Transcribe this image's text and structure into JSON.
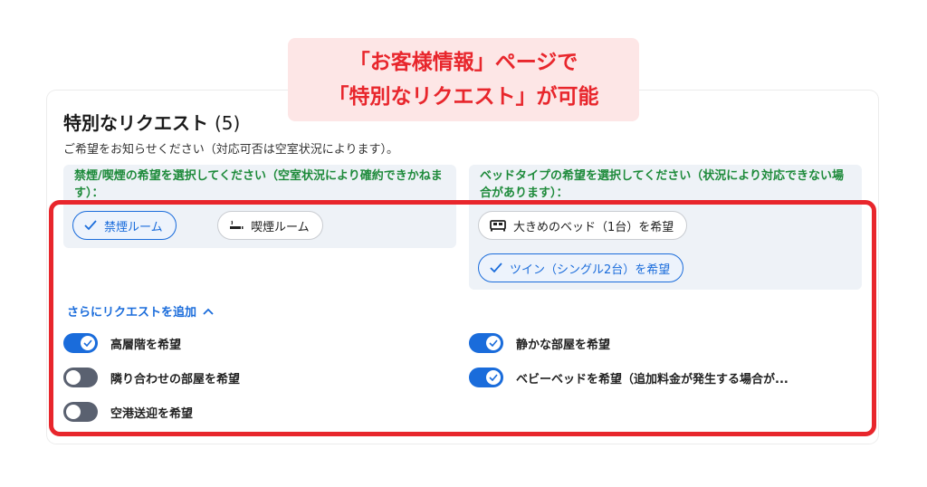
{
  "callout": {
    "line1": "「お客様情報」ページで",
    "line2": "「特別なリクエスト」が可能"
  },
  "section": {
    "title": "特別なリクエスト",
    "count": "(5)",
    "subtitle": "ご希望をお知らせください（対応可否は空室状況によります）。"
  },
  "smoking": {
    "heading": "禁煙/喫煙の希望を選択してください（空室状況により確約できかねます）：",
    "options": [
      {
        "label": "禁煙ルーム",
        "icon": "check-icon",
        "selected": true
      },
      {
        "label": "喫煙ルーム",
        "icon": "smoking-icon",
        "selected": false
      }
    ]
  },
  "bed": {
    "heading": "ベッドタイプの希望を選択してください（状況により対応できない場合があります）：",
    "options": [
      {
        "label": "大きめのベッド（1台）を希望",
        "icon": "bed-icon",
        "selected": false
      },
      {
        "label": "ツイン（シングル2台）を希望",
        "icon": "check-icon",
        "selected": true
      }
    ]
  },
  "more": {
    "label": "さらにリクエストを追加",
    "icon": "chevron-up-icon"
  },
  "toggles": [
    {
      "label": "高層階を希望",
      "on": true
    },
    {
      "label": "静かな部屋を希望",
      "on": true
    },
    {
      "label": "隣り合わせの部屋を希望",
      "on": false
    },
    {
      "label": "ベビーベッドを希望（追加料金が発生する場合が...",
      "on": true
    },
    {
      "label": "空港送迎を希望",
      "on": false
    }
  ],
  "colors": {
    "accent": "#1a6cdb",
    "highlight_red": "#e8262c",
    "heading_green": "#1d8a3a",
    "toggle_off": "#5a6170"
  }
}
